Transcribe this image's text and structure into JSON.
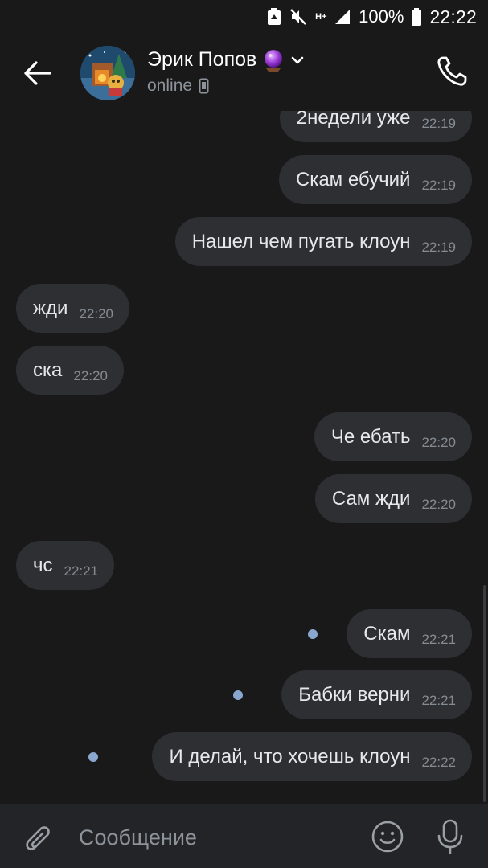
{
  "status_bar": {
    "battery_percent": "100%",
    "time": "22:22",
    "network_label": "H+"
  },
  "header": {
    "contact_name": "Эрик Попов",
    "status": "online",
    "badge_icon": "crystal-ball-emoji"
  },
  "messages": [
    {
      "direction": "out",
      "text": "2недели уже",
      "time": "22:19"
    },
    {
      "direction": "out",
      "text": "Скам ебучий",
      "time": "22:19"
    },
    {
      "direction": "out",
      "text": "Нашел чем пугать клоун",
      "time": "22:19"
    },
    {
      "direction": "in",
      "text": "жди",
      "time": "22:20"
    },
    {
      "direction": "in",
      "text": "ска",
      "time": "22:20"
    },
    {
      "direction": "out",
      "text": "Че ебать",
      "time": "22:20"
    },
    {
      "direction": "out",
      "text": "Сам жди",
      "time": "22:20"
    },
    {
      "direction": "in",
      "text": "чс",
      "time": "22:21"
    },
    {
      "direction": "out",
      "text": "Скам",
      "time": "22:21",
      "unread": true
    },
    {
      "direction": "out",
      "text": "Бабки верни",
      "time": "22:21",
      "unread": true
    },
    {
      "direction": "out",
      "text": "И делай, что хочешь клоун",
      "time": "22:22",
      "unread": true
    }
  ],
  "composer": {
    "placeholder": "Сообщение"
  },
  "colors": {
    "background": "#19191a",
    "bubble": "#2e2f33",
    "unread_dot": "#8aa7cf",
    "composer": "#232427"
  }
}
